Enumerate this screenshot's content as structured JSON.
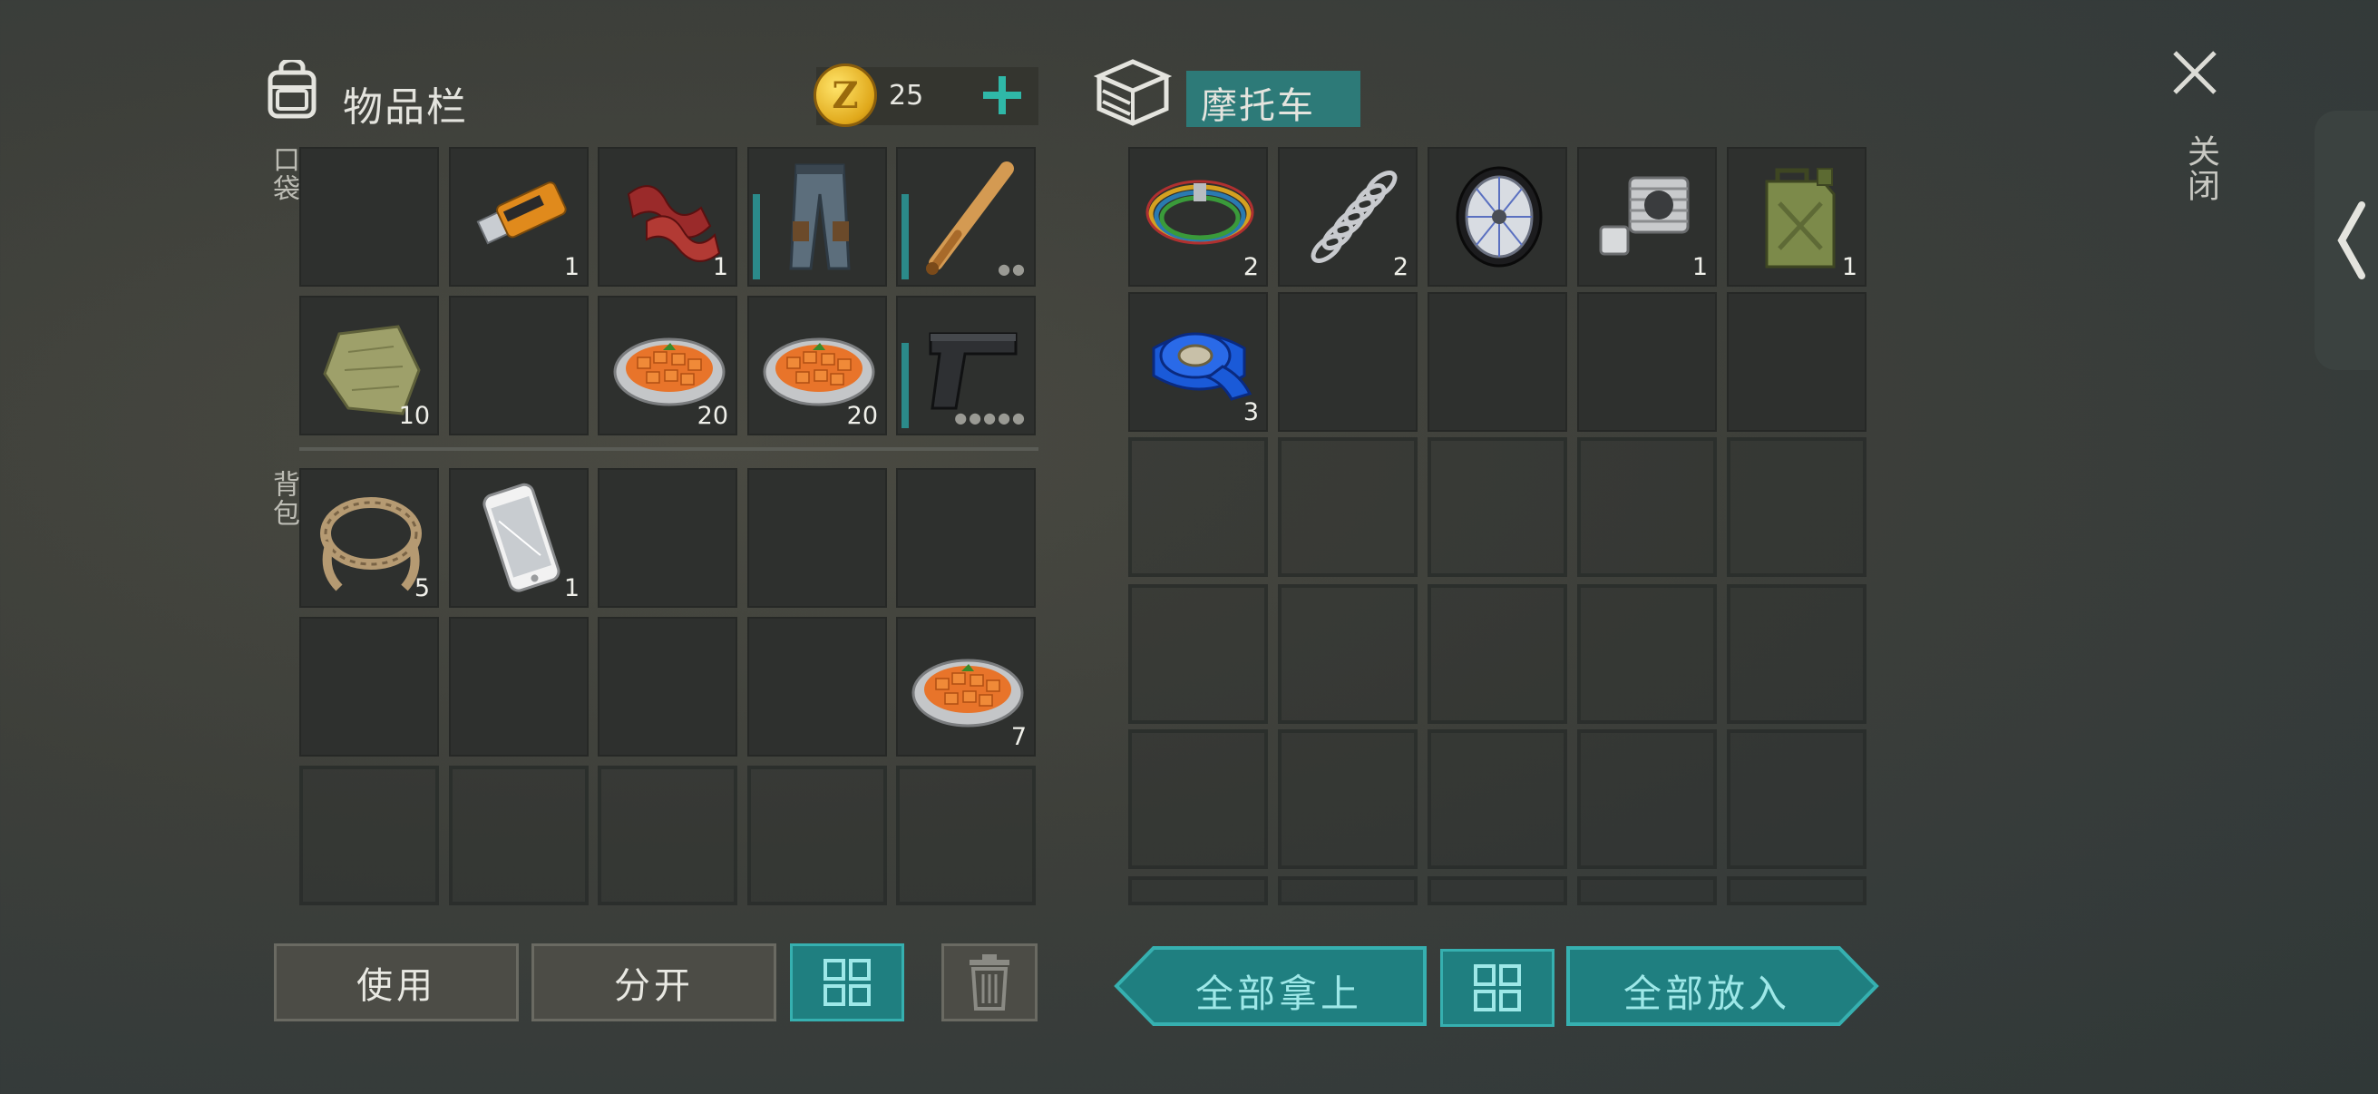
{
  "inventory": {
    "title": "物品栏",
    "coins": "25",
    "coin_symbol": "Z",
    "pocket_label": "口袋",
    "backpack_label": "背包",
    "pocket_slots": [
      {
        "item": "",
        "count": ""
      },
      {
        "item": "usb-drive",
        "count": "1"
      },
      {
        "item": "bacon",
        "count": "1"
      },
      {
        "item": "pants",
        "count": ""
      },
      {
        "item": "baseball-bat",
        "count": ""
      },
      {
        "item": "cloth-scrap",
        "count": "10"
      },
      {
        "item": "",
        "count": ""
      },
      {
        "item": "carrot-dish",
        "count": "20"
      },
      {
        "item": "carrot-dish",
        "count": "20"
      },
      {
        "item": "pistol",
        "count": ""
      }
    ],
    "backpack_slots": [
      {
        "item": "rope",
        "count": "5"
      },
      {
        "item": "smartphone",
        "count": "1"
      },
      {
        "item": "",
        "count": ""
      },
      {
        "item": "",
        "count": ""
      },
      {
        "item": "",
        "count": ""
      },
      {
        "item": "",
        "count": ""
      },
      {
        "item": "",
        "count": ""
      },
      {
        "item": "",
        "count": ""
      },
      {
        "item": "",
        "count": ""
      },
      {
        "item": "carrot-dish",
        "count": "7"
      }
    ]
  },
  "container": {
    "title": "摩托车",
    "slots": [
      {
        "item": "wires",
        "count": "2"
      },
      {
        "item": "spring",
        "count": "2"
      },
      {
        "item": "wheel",
        "count": ""
      },
      {
        "item": "engine-cylinder",
        "count": "1"
      },
      {
        "item": "jerrycan",
        "count": "1"
      },
      {
        "item": "duct-tape",
        "count": "3"
      }
    ]
  },
  "buttons": {
    "use": "使用",
    "split": "分开",
    "take_all": "全部拿上",
    "put_all": "全部放入"
  },
  "close_label": "关闭",
  "colors": {
    "accent_teal": "#1f7f80",
    "teal_text": "#9ee8e8",
    "plus_green": "#2fb8a8"
  }
}
